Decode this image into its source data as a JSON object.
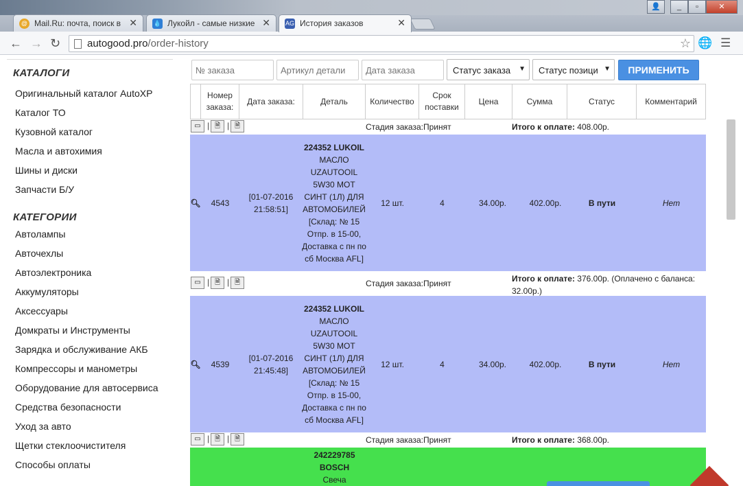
{
  "browser": {
    "tabs": [
      {
        "label": "Mail.Ru: почта, поиск в и",
        "favicon": "mailru-icon"
      },
      {
        "label": "Лукойл - самые низкие ц",
        "favicon": "lukoil-drop-icon"
      },
      {
        "label": "История заказов",
        "favicon": "AG"
      }
    ],
    "url_host": "autogood.pro",
    "url_path": "/order-history"
  },
  "sidebar": {
    "catalogs_title": "КАТАЛОГИ",
    "catalogs": [
      "Оригинальный каталог AutoXP",
      "Каталог ТО",
      "Кузовной каталог",
      "Масла и автохимия",
      "Шины и диски",
      "Запчасти Б/У"
    ],
    "categories_title": "КАТЕГОРИИ",
    "categories": [
      "Автолампы",
      "Авточехлы",
      "Автоэлектроника",
      "Аккумуляторы",
      "Аксессуары",
      "Домкраты и Инструменты",
      "Зарядка и обслуживание АКБ",
      "Компрессоры и манометры",
      "Оборудование для автосервиса",
      "Средства безопасности",
      "Уход за авто",
      "Щетки стеклоочистителя",
      "Способы оплаты"
    ]
  },
  "filters": {
    "order_no_placeholder": "№ заказа",
    "article_placeholder": "Артикул детали",
    "date_placeholder": "Дата заказа",
    "order_status": "Статус заказа",
    "position_status": "Статус позици",
    "apply": "ПРИМЕНИТЬ"
  },
  "table": {
    "headers": [
      "Номер заказа:",
      "Дата заказа:",
      "Деталь",
      "Количество",
      "Срок поставки",
      "Цена",
      "Сумма",
      "Статус",
      "Комментарий"
    ],
    "orders": [
      {
        "stage": "Стадия заказа:Принят",
        "total_label": "Итого к оплате:",
        "total_value": "408.00р.",
        "number": "4543",
        "date": "[01-07-2016 21:58:51]",
        "part_code": "224352 LUKOIL",
        "part_desc": "МАСЛО UZAUTOOIL 5W30 МОТ СИНТ (1Л) ДЛЯ АВТОМОБИЛЕЙ [Склад: № 15 Отпр. в 15-00, Доставка с пн по сб Москва AFL]",
        "qty": "12 шт.",
        "term": "4",
        "price": "34.00р.",
        "sum": "402.00р.",
        "status": "В пути",
        "comment": "Нет"
      },
      {
        "stage": "Стадия заказа:Принят",
        "total_label": "Итого к оплате:",
        "total_value": "376.00р. (Оплачено с баланса: 32.00р.)",
        "number": "4539",
        "date": "[01-07-2016 21:45:48]",
        "part_code": "224352 LUKOIL",
        "part_desc": "МАСЛО UZAUTOOIL 5W30 МОТ СИНТ (1Л) ДЛЯ АВТОМОБИЛЕЙ [Склад: № 15 Отпр. в 15-00, Доставка с пн по сб Москва AFL]",
        "qty": "12 шт.",
        "term": "4",
        "price": "34.00р.",
        "sum": "402.00р.",
        "status": "В пути",
        "comment": "Нет"
      },
      {
        "stage": "Стадия заказа:Принят",
        "total_label": "Итого к оплате:",
        "total_value": "368.00р.",
        "part_code_a": "242229785",
        "part_code_b": "BOSCH",
        "part_desc": "Свеча"
      }
    ]
  },
  "colors": {
    "row_blue": "#b3bcf8",
    "row_green": "#45e04d",
    "apply_btn": "#4a90e2"
  }
}
